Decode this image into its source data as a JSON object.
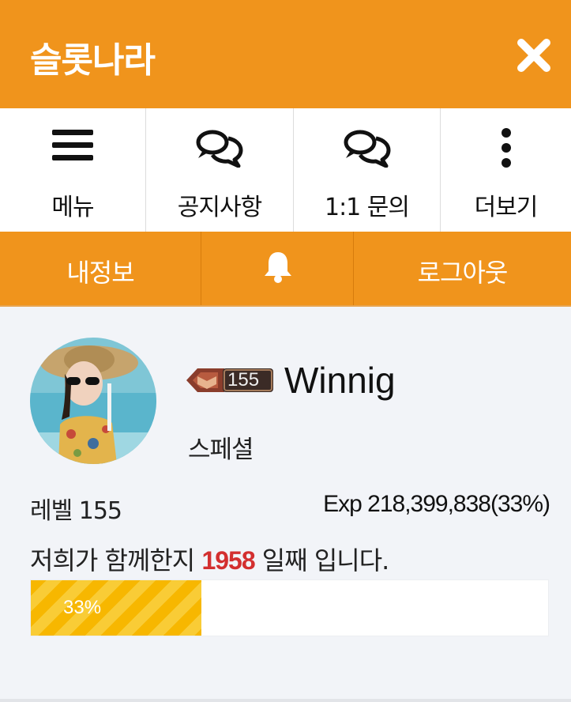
{
  "header": {
    "title": "슬롯나라",
    "close_icon": "close-icon"
  },
  "nav": {
    "items": [
      {
        "label": "메뉴",
        "icon": "hamburger-menu-icon"
      },
      {
        "label": "공지사항",
        "icon": "chat-bubbles-icon"
      },
      {
        "label": "1:1 문의",
        "icon": "chat-bubbles-icon"
      },
      {
        "label": "더보기",
        "icon": "more-vertical-icon"
      }
    ]
  },
  "action_bar": {
    "my_info_label": "내정보",
    "bell_icon": "bell-icon",
    "logout_label": "로그아웃"
  },
  "profile": {
    "avatar": "avatar",
    "badge_level": "155",
    "username": "Winnig",
    "rank": "스페셜"
  },
  "stats": {
    "level_text": "레벨 155",
    "exp_text": "Exp 218,399,838(33%)",
    "days_prefix": "저희가 함께한지 ",
    "days_count": "1958",
    "days_suffix": " 일째 입니다."
  },
  "progress": {
    "percent": 33,
    "percent_label": "33%"
  },
  "colors": {
    "accent": "#f0941c",
    "progress_fill": "#f7b700",
    "highlight": "#d32f2f",
    "panel_bg": "#f2f4f8"
  }
}
